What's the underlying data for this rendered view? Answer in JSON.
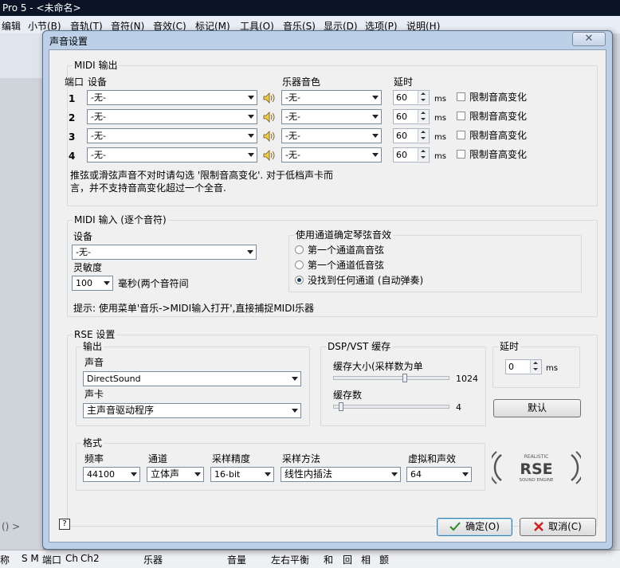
{
  "app": {
    "title": "Pro 5 - <未命名>",
    "menu": [
      "编辑",
      "小节(B)",
      "音轨(T)",
      "音符(N)",
      "音效(C)",
      "标记(M)",
      "工具(O)",
      "音乐(S)",
      "显示(D)",
      "选项(P)",
      "说明(H)"
    ],
    "status": [
      "称",
      "S M",
      "端口",
      "Ch",
      "Ch2",
      "乐器",
      "音量",
      "左右平衡",
      "和",
      "回",
      "相",
      "颤"
    ],
    "bottom_left_text": "() >"
  },
  "dialog": {
    "title": "声音设置",
    "close_glyph": "✕",
    "midi_out": {
      "title": "MIDI 输出",
      "col_port": "端口",
      "col_device": "设备",
      "col_instrument": "乐器音色",
      "col_delay": "延时",
      "rows": [
        {
          "port": "1",
          "device": "-无-",
          "instrument": "-无-",
          "delay": "60",
          "unit": "ms",
          "limit_label": "限制音高变化"
        },
        {
          "port": "2",
          "device": "-无-",
          "instrument": "-无-",
          "delay": "60",
          "unit": "ms",
          "limit_label": "限制音高变化"
        },
        {
          "port": "3",
          "device": "-无-",
          "instrument": "-无-",
          "delay": "60",
          "unit": "ms",
          "limit_label": "限制音高变化"
        },
        {
          "port": "4",
          "device": "-无-",
          "instrument": "-无-",
          "delay": "60",
          "unit": "ms",
          "limit_label": "限制音高变化"
        }
      ],
      "note_line1": "推弦或滑弦声音不对时请勾选 '限制音高变化'. 对于低档声卡而",
      "note_line2": "言，并不支持音高变化超过一个全音."
    },
    "midi_in": {
      "title": "MIDI 输入 (逐个音符)",
      "device_label": "设备",
      "device_value": "-无-",
      "sensitivity_label": "灵敏度",
      "sensitivity_value": "100",
      "sensitivity_unit": "毫秒(两个音符间",
      "channel_group_title": "使用通道确定琴弦音效",
      "radios": [
        {
          "label": "第一个通道高音弦",
          "selected": false
        },
        {
          "label": "第一个通道低音弦",
          "selected": false
        },
        {
          "label": "没找到任何通道 (自动弹奏)",
          "selected": true
        }
      ],
      "hint": "提示: 使用菜单'音乐->MIDI输入打开',直接捕捉MIDI乐器"
    },
    "rse": {
      "title": "RSE 设置",
      "output_title": "输出",
      "sound_label": "声音",
      "sound_value": "DirectSound",
      "card_label": "声卡",
      "card_value": "主声音驱动程序",
      "cache_title": "DSP/VST 缓存",
      "cache_size_label": "缓存大小(采样数为单",
      "cache_size_value": "1024",
      "cache_size_fraction": 0.62,
      "cache_count_label": "缓存数",
      "cache_count_value": "4",
      "cache_count_fraction": 0.05,
      "delay_title": "延时",
      "delay_value": "0",
      "delay_unit": "ms",
      "default_button": "默认",
      "format": {
        "title": "格式",
        "freq_label": "频率",
        "freq_value": "44100",
        "channel_label": "通道",
        "channel_value": "立体声",
        "precision_label": "采样精度",
        "precision_value": "16-bit",
        "method_label": "采样方法",
        "method_value": "线性内插法",
        "virtual_label": "虚拟和声效",
        "virtual_value": "64"
      },
      "logo": {
        "top": "REALISTIC",
        "main": "RSE",
        "bottom": "SOUND ENGINE"
      }
    },
    "footer": {
      "help_glyph": "?",
      "ok_label": "确定(O)",
      "cancel_label": "取消(C)"
    }
  }
}
